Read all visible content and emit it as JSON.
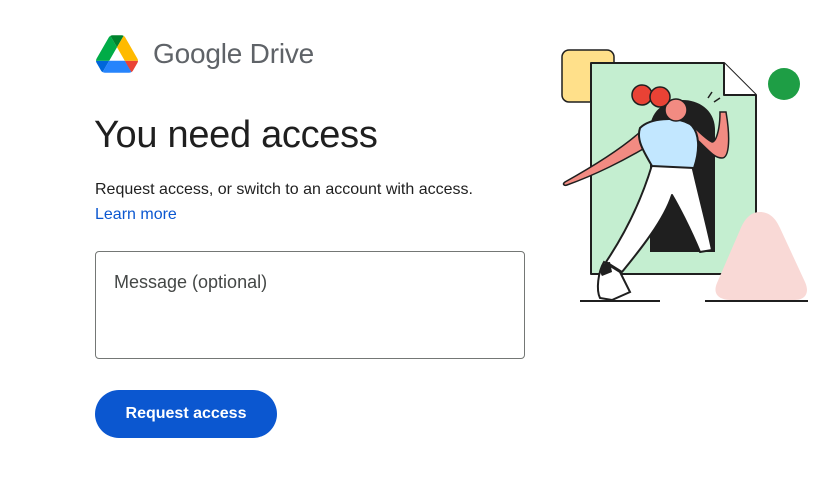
{
  "brand": {
    "logo_icon": "google-drive-logo-icon",
    "name": "Google Drive"
  },
  "main": {
    "heading": "You need access",
    "description": "Request access, or switch to an account with access.",
    "learn_more": "Learn more",
    "message": {
      "value": "",
      "placeholder": "Message (optional)"
    },
    "request_button": "Request access"
  },
  "colors": {
    "accent": "#0b57d0",
    "heading": "#1f1f1f",
    "wordmark": "#5f6368",
    "illustration_green": "#c4eed0",
    "illustration_yellow": "#ffe08a",
    "illustration_pink": "#f9d9d6",
    "illustration_dot": "#1e9e45"
  }
}
